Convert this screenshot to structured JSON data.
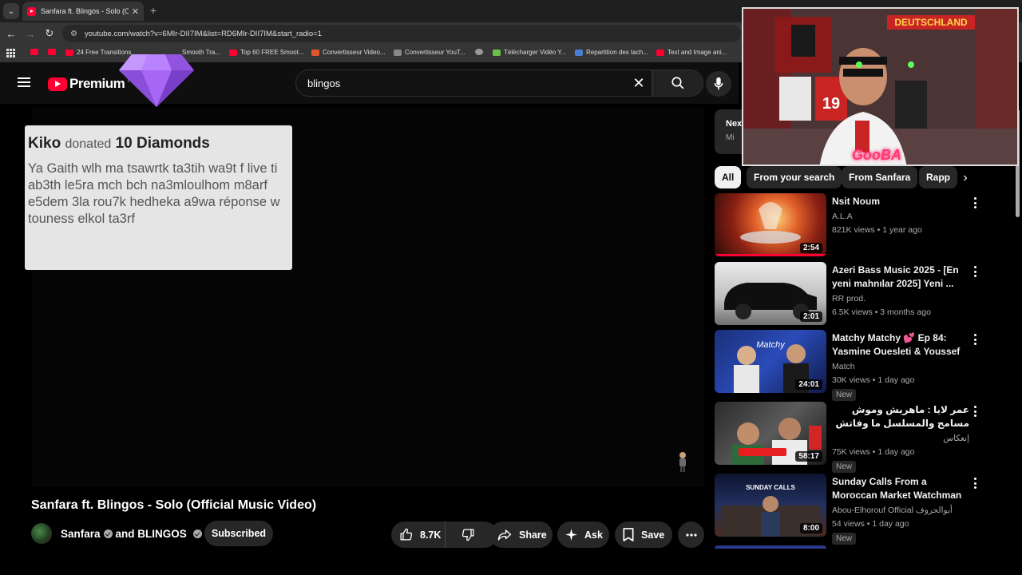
{
  "browser": {
    "tab_title": "Sanfara ft. Blingos - Solo (Offici",
    "url": "youtube.com/watch?v=6MIr-DII7IM&list=RD6MIr-DII7IM&start_radio=1",
    "bookmarks": [
      "24 Free Transitions",
      "Smooth Tra...",
      "Top 60 FREE Smoot...",
      "Convertisseur Video...",
      "Convertisseur YouT...",
      "Télécharger Vidéo Y...",
      "Repartition des tach...",
      "Text and Image ani..."
    ]
  },
  "header": {
    "brand": "Premium",
    "brand_suffix": "TN",
    "search_value": "blingos"
  },
  "donation": {
    "donor": "Kiko",
    "verb": "donated",
    "amount": "10 Diamonds",
    "message": "Ya Gaith wlh ma tsawrtk ta3tih wa9t f live ti ab3th le5ra mch bch na3mloulhom m8arf e5dem 3la rou7k hedheka a9wa réponse w touness elkol ta3rf"
  },
  "video": {
    "title": "Sanfara ft. Blingos - Solo (Official Music Video)",
    "owner": "Sanfara",
    "owner_and": "and BLINGOS",
    "subscribe_label": "Subscribed",
    "likes": "8.7K",
    "share_label": "Share",
    "ask_label": "Ask",
    "save_label": "Save"
  },
  "sidebar": {
    "next_label": "Nex",
    "next_sub": "Mi",
    "chips": [
      "All",
      "From your search",
      "From Sanfara",
      "Rapp"
    ],
    "recommendations": [
      {
        "title": "Nsit Noum",
        "channel": "A.L.A",
        "meta": "821K views • 1 year ago",
        "duration": "2:54",
        "badge": ""
      },
      {
        "title": "Azeri Bass Music 2025 - [En yeni mahnılar 2025] Yeni ...",
        "channel": "RR prod.",
        "meta": "6.5K views • 3 months ago",
        "duration": "2:01",
        "badge": ""
      },
      {
        "title": "Matchy Matchy 💕 Ep 84: Yasmine Ouesleti & Youssef ...",
        "channel": "Match",
        "meta": "30K views • 1 day ago",
        "duration": "24:01",
        "badge": "New"
      },
      {
        "title": "عمر لايا : ماهريش وموش مسامح والمسلسل ما وفاتش",
        "channel": "إنعكاس",
        "meta": "75K views • 1 day ago",
        "duration": "58:17",
        "badge": "New"
      },
      {
        "title": "Sunday Calls  From a Moroccan Market Watchman to the Digit...",
        "channel": "Abou-Elhorouf Official أبوالحروف",
        "meta": "54 views • 1 day ago",
        "duration": "8:00",
        "badge": "New"
      }
    ]
  },
  "webcam": {
    "name": "GooBA",
    "shirt_number": "19",
    "banner": "DEUTSCHLAND"
  }
}
